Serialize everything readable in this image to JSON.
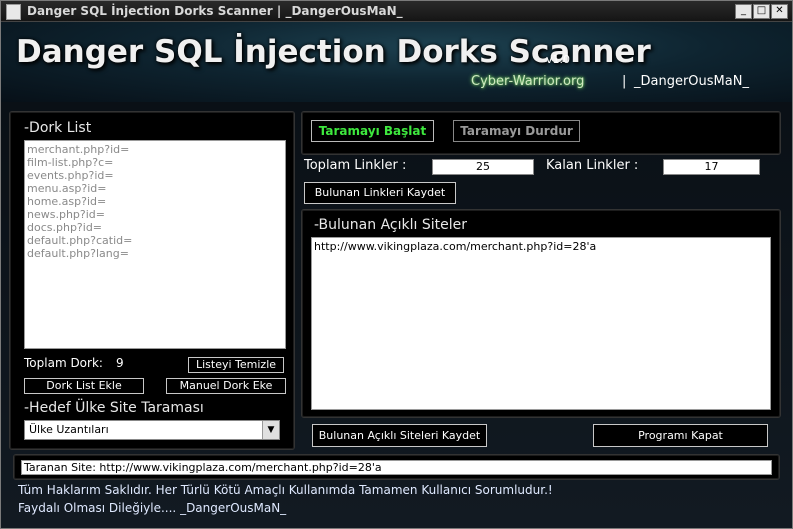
{
  "window": {
    "title": "Danger SQL İnjection Dorks Scanner | _DangerOusMaN_",
    "controls": [
      "_",
      "□",
      "✕"
    ]
  },
  "header": {
    "title": "Danger SQL İnjection Dorks Scanner",
    "version": "v1.0",
    "site": "Cyber-Warrior.org",
    "separator": "|",
    "author": "_DangerOusMaN_"
  },
  "dork_panel": {
    "label": "-Dork List",
    "items": [
      "merchant.php?id=",
      "film-list.php?c=",
      "events.php?id=",
      "menu.asp?id=",
      "home.asp?id=",
      "news.php?id=",
      "docs.php?id=",
      "default.php?catid=",
      "default.php?lang="
    ],
    "total_label": "Toplam Dork:",
    "total_value": "9",
    "clear_button": "Listeyi Temizle",
    "add_list_button": "Dork List Ekle",
    "manual_add_button": "Manuel Dork Eke",
    "country_label": "-Hedef Ülke Site Taraması",
    "country_select": "Ülke Uzantıları"
  },
  "scan_panel": {
    "start_button": "Taramayı Başlat",
    "stop_button": "Taramayı Durdur",
    "total_links_label": "Toplam Linkler :",
    "total_links_value": "25",
    "remaining_links_label": "Kalan Linkler :",
    "remaining_links_value": "17",
    "save_links_button": "Bulunan Linkleri Kaydet"
  },
  "vuln_panel": {
    "label": "-Bulunan Açıklı Siteler",
    "items": [
      "http://www.vikingplaza.com/merchant.php?id=28'a"
    ]
  },
  "actions": {
    "save_vuln_button": "Bulunan Açıklı Siteleri Kaydet",
    "close_button": "Programı Kapat"
  },
  "status": {
    "scanned_site": "Taranan Site: http://www.vikingplaza.com/merchant.php?id=28'a"
  },
  "footer": {
    "line1": "Tüm Haklarım Saklıdır. Her Türlü Kötü Amaçlı Kullanımda Tamamen Kullanıcı Sorumludur.!",
    "line2": "Faydalı Olması Dileğiyle.... _DangerOusMaN_"
  },
  "colors": {
    "start_green": "#3ee83e",
    "site_glow": "#7bd36c"
  }
}
